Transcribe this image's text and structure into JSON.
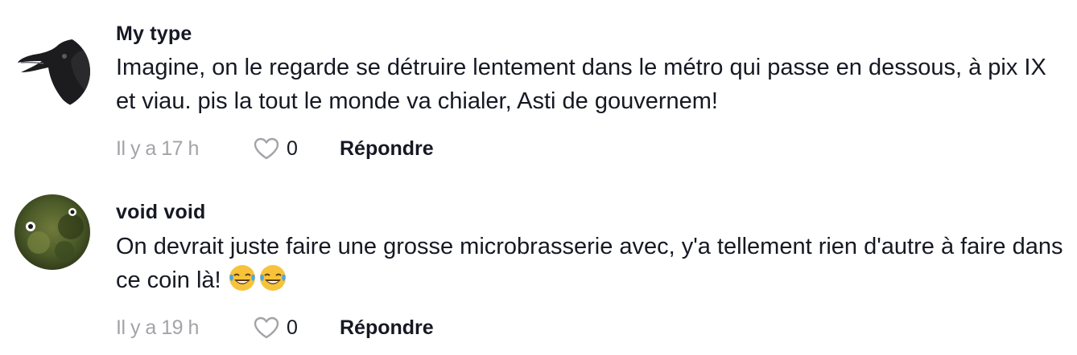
{
  "comments": [
    {
      "username": "My type",
      "text": "Imagine, on le regarde se détruire lentement dans le métro qui passe en dessous, à pix IX et viau. pis la tout le monde va chialer, Asti de gouvernem!",
      "time": "Il y a 17 h",
      "likes": "0",
      "reply_label": "Répondre",
      "avatar_icon": "crow-avatar"
    },
    {
      "username": "void void",
      "text": "On devrait juste faire une grosse microbrasserie avec, y'a tellement rien d'autre à faire dans ce coin là!",
      "emojis": [
        "😂",
        "😂"
      ],
      "time": "Il y a 19 h",
      "likes": "0",
      "reply_label": "Répondre",
      "avatar_icon": "lizard-eye-avatar"
    }
  ],
  "colors": {
    "text": "#161823",
    "muted": "#a3a3a8",
    "background": "#ffffff"
  }
}
